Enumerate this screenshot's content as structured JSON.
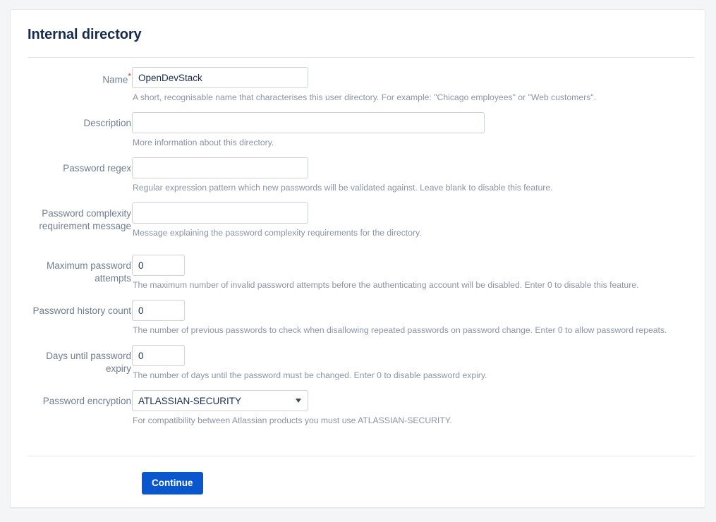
{
  "page": {
    "title": "Internal directory"
  },
  "form": {
    "fields": [
      {
        "key": "name",
        "label": "Name",
        "required": true,
        "required_marker": "*",
        "type": "text",
        "value": "OpenDevStack",
        "placeholder": "",
        "help": "A short, recognisable name that characterises this user directory. For example: \"Chicago employees\" or \"Web customers\"."
      },
      {
        "key": "description",
        "label": "Description",
        "required": false,
        "type": "text",
        "value": "",
        "placeholder": "",
        "help": "More information about this directory."
      },
      {
        "key": "password_regex",
        "label": "Password regex",
        "required": false,
        "type": "text",
        "value": "",
        "placeholder": "",
        "help": "Regular expression pattern which new passwords will be validated against. Leave blank to disable this feature."
      },
      {
        "key": "password_complexity_message",
        "label": "Password complexity requirement message",
        "required": false,
        "type": "text",
        "value": "",
        "placeholder": "",
        "help": "Message explaining the password complexity requirements for the directory."
      },
      {
        "key": "max_password_attempts",
        "label": "Maximum password attempts",
        "required": false,
        "type": "text",
        "value": "0",
        "placeholder": "",
        "help": "The maximum number of invalid password attempts before the authenticating account will be disabled. Enter 0 to disable this feature."
      },
      {
        "key": "password_history_count",
        "label": "Password history count",
        "required": false,
        "type": "text",
        "value": "0",
        "placeholder": "",
        "help": "The number of previous passwords to check when disallowing repeated passwords on password change. Enter 0 to allow password repeats."
      },
      {
        "key": "days_until_password_expiry",
        "label": "Days until password expiry",
        "required": false,
        "type": "text",
        "value": "0",
        "placeholder": "",
        "help": "The number of days until the password must be changed. Enter 0 to disable password expiry."
      },
      {
        "key": "password_encryption",
        "label": "Password encryption",
        "required": false,
        "type": "select",
        "value": "ATLASSIAN-SECURITY",
        "options": [
          "ATLASSIAN-SECURITY"
        ],
        "help": "For compatibility between Atlassian products you must use ATLASSIAN-SECURITY."
      }
    ],
    "submit_label": "Continue"
  },
  "colors": {
    "page_background": "#f4f5f7",
    "card_background": "#ffffff",
    "title_text": "#172b4d",
    "label_text": "#6f7d8f",
    "help_text": "#8a94a6",
    "input_border": "#ccd2db",
    "primary_button": "#0a56cf",
    "required_marker": "#d04437"
  }
}
